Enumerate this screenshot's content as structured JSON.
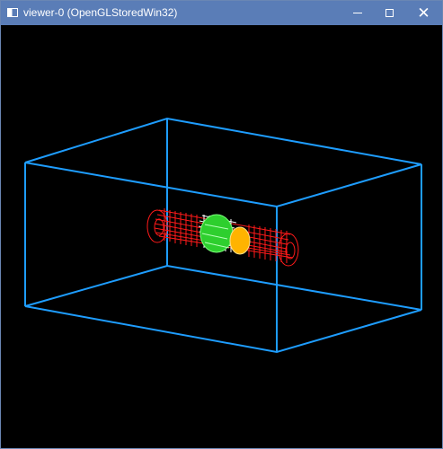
{
  "window": {
    "title": "viewer-0 (OpenGLStoredWin32)",
    "controls": {
      "minimize_label": "—",
      "maximize_label": "",
      "close_label": "✕"
    }
  },
  "scene": {
    "background": "#000000",
    "box_color": "#1e9dff",
    "tube_color": "#ff0000",
    "inner_tube_color": "#ffffff",
    "core_color": "#2ecf2e",
    "cap_color": "#ffb300"
  }
}
